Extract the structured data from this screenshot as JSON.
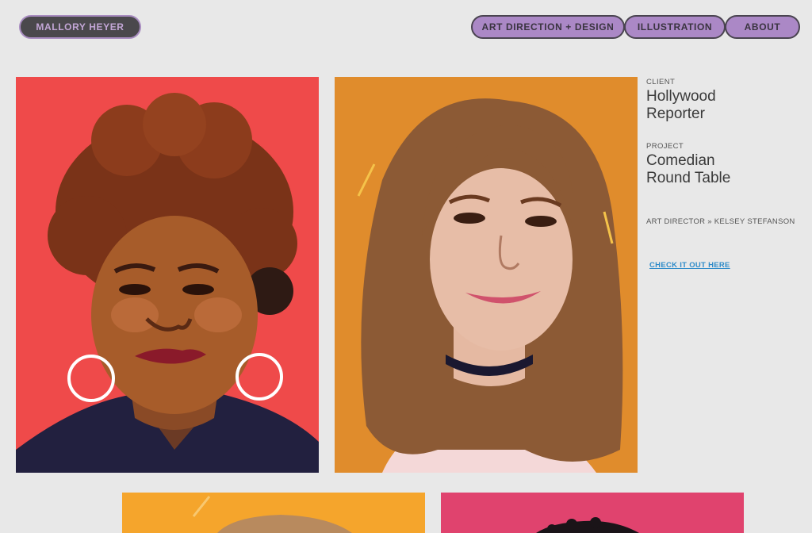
{
  "site": {
    "name": "MALLORY HEYER"
  },
  "nav": [
    {
      "label": "ART DIRECTION + DESIGN"
    },
    {
      "label": "ILLUSTRATION"
    },
    {
      "label": "ABOUT"
    }
  ],
  "project": {
    "client_label": "CLIENT",
    "client_line1": "Hollywood",
    "client_line2": "Reporter",
    "project_label": "PROJECT",
    "project_line1": "Comedian",
    "project_line2": "Round Table",
    "credit": "ART DIRECTOR » KELSEY STEFANSON",
    "link": "CHECK IT OUT HERE"
  },
  "colors": {
    "background": "#e8e8e8",
    "nav_pill": "#ab88c6",
    "brand_pill": "#4a484c",
    "link": "#2e8bc9",
    "art_red": "#ef4a4a",
    "art_orange": "#e08c2c",
    "art_yellow": "#f5a52c",
    "art_pink": "#e0436e"
  },
  "gallery": [
    {
      "name": "portrait-curly-hair-hoop-earrings"
    },
    {
      "name": "portrait-wavy-brown-hair-choker"
    },
    {
      "name": "portrait-light-hair-yellow-bg"
    },
    {
      "name": "portrait-dark-hair-pink-bg"
    }
  ]
}
